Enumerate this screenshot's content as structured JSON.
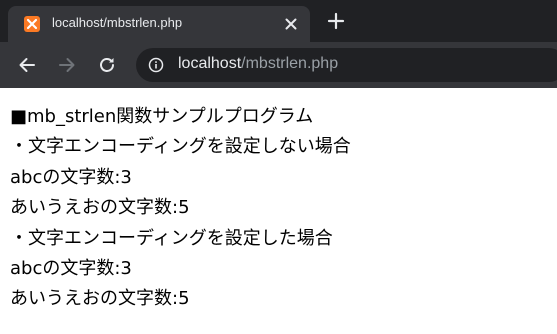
{
  "browser": {
    "tab_title": "localhost/mbstrlen.php",
    "url_host": "localhost",
    "url_path": "/mbstrlen.php"
  },
  "colors": {
    "chrome_dark": "#202124",
    "chrome_toolbar": "#35363a",
    "favicon": "#fb7a24"
  },
  "icons": {
    "favicon": "xampp-icon",
    "close": "close-icon",
    "new_tab": "plus-icon",
    "back": "back-arrow-icon",
    "forward": "forward-arrow-icon",
    "reload": "reload-icon",
    "info": "info-icon"
  },
  "page": {
    "lines": [
      "■mb_strlen関数サンプルプログラム",
      "・文字エンコーディングを設定しない場合",
      "abcの文字数:3",
      "あいうえおの文字数:5",
      "・文字エンコーディングを設定した場合",
      "abcの文字数:3",
      "あいうえおの文字数:5"
    ]
  }
}
